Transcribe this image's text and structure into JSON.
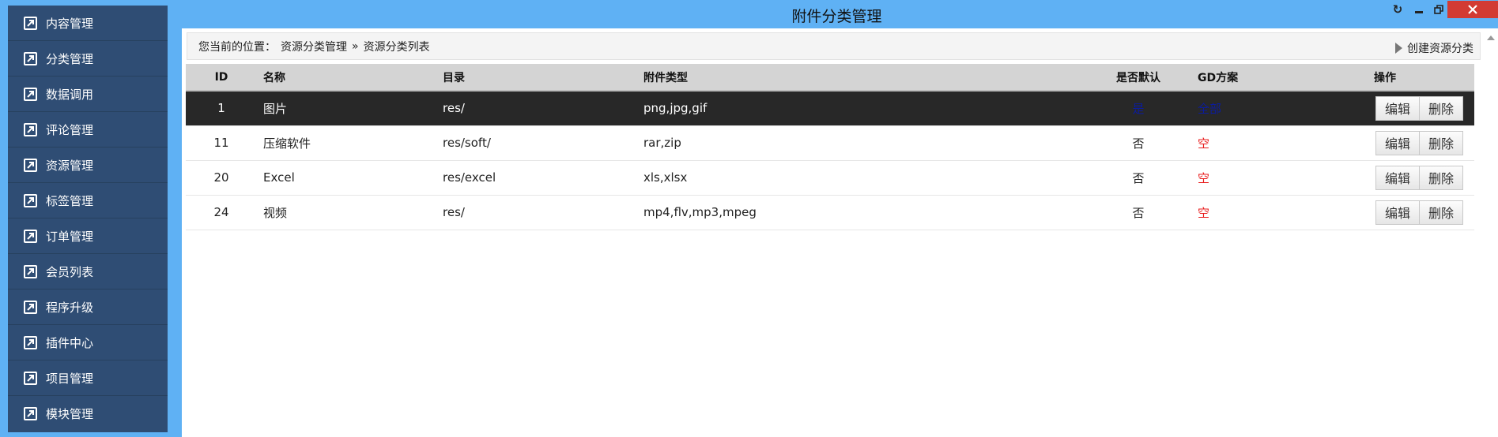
{
  "window": {
    "title": "附件分类管理",
    "controls": [
      "refresh-icon",
      "minimize-icon",
      "restore-icon",
      "close-icon"
    ]
  },
  "sidebar": {
    "items": [
      {
        "label": "内容管理"
      },
      {
        "label": "分类管理"
      },
      {
        "label": "数据调用"
      },
      {
        "label": "评论管理"
      },
      {
        "label": "资源管理"
      },
      {
        "label": "标签管理"
      },
      {
        "label": "订单管理"
      },
      {
        "label": "会员列表"
      },
      {
        "label": "程序升级"
      },
      {
        "label": "插件中心"
      },
      {
        "label": "项目管理"
      },
      {
        "label": "模块管理"
      }
    ]
  },
  "breadcrumb": {
    "prefix": "您当前的位置：",
    "level1": "资源分类管理",
    "separator": "»",
    "level2": "资源分类列表"
  },
  "actions": {
    "create_label": "创建资源分类"
  },
  "table": {
    "headers": {
      "id": "ID",
      "name": "名称",
      "dir": "目录",
      "types": "附件类型",
      "default": "是否默认",
      "gd": "GD方案",
      "ops": "操作"
    },
    "rows": [
      {
        "id": "1",
        "name": "图片",
        "dir": "res/",
        "types": "png,jpg,gif",
        "default": "是",
        "gd": "全部",
        "edit": "编辑",
        "delete": "删除"
      },
      {
        "id": "11",
        "name": "压缩软件",
        "dir": "res/soft/",
        "types": "rar,zip",
        "default": "否",
        "gd": "空",
        "edit": "编辑",
        "delete": "删除"
      },
      {
        "id": "20",
        "name": "Excel",
        "dir": "res/excel",
        "types": "xls,xlsx",
        "default": "否",
        "gd": "空",
        "edit": "编辑",
        "delete": "删除"
      },
      {
        "id": "24",
        "name": "视频",
        "dir": "res/",
        "types": "mp4,flv,mp3,mpeg",
        "default": "否",
        "gd": "空",
        "edit": "编辑",
        "delete": "删除"
      }
    ]
  },
  "colors": {
    "sidebar_bg": "#2f4d74",
    "window_bg": "#5fb1f4",
    "selected_row": "#282828",
    "gd_all": "#0b1c9e",
    "gd_empty": "#e81c1c",
    "close_button": "#d23b33"
  }
}
